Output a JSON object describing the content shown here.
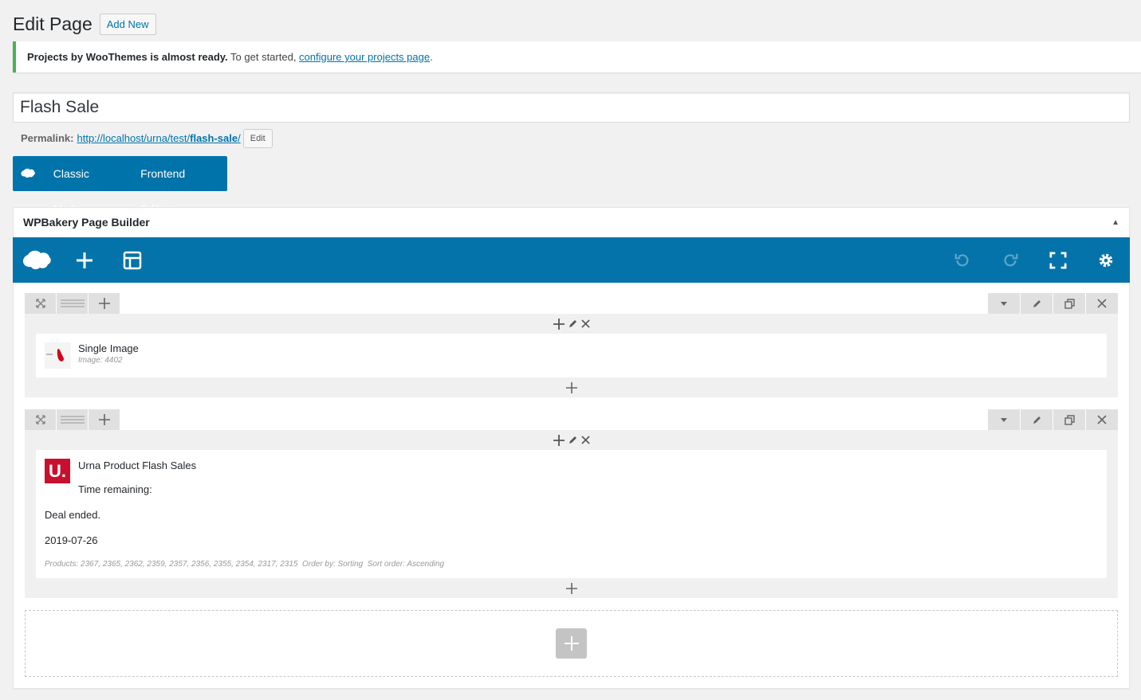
{
  "page": {
    "title": "Edit Page",
    "add_new_label": "Add New"
  },
  "notice": {
    "bold_text": "Projects by WooThemes is almost ready.",
    "text": " To get started, ",
    "link_text": "configure your projects page",
    "suffix": "."
  },
  "post": {
    "title_value": "Flash Sale",
    "permalink_label": "Permalink:",
    "permalink_base": "http://localhost/urna/test/",
    "permalink_slug": "flash-sale",
    "permalink_trail": "/",
    "permalink_edit_label": "Edit"
  },
  "mode_bar": {
    "classic_label": "Classic Mode",
    "frontend_label": "Frontend Editor"
  },
  "builder": {
    "panel_title": "WPBakery Page Builder",
    "toolbar": {
      "icons": [
        "wpbakery-logo-icon",
        "add-element-icon",
        "templates-icon",
        "undo-icon",
        "redo-icon",
        "fullscreen-icon",
        "settings-icon"
      ]
    },
    "rows": [
      {
        "element": {
          "title": "Single Image",
          "subtitle": "Image: 4402"
        }
      },
      {
        "element": {
          "title": "Urna Product Flash Sales",
          "time_remaining": "Time remaining:",
          "deal_status": "Deal ended.",
          "date": "2019-07-26",
          "params": "Products: 2367, 2365, 2362, 2359, 2357, 2356, 2355, 2354, 2317, 2315  Order by: Sorting  Sort order: Ascending",
          "logo_text": "U."
        }
      }
    ]
  },
  "colors": {
    "accent": "#0073aa",
    "notice_success": "#46b450",
    "urna_red": "#c8102e"
  }
}
